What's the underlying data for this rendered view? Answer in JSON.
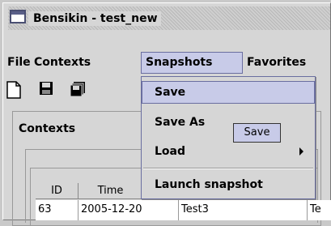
{
  "window": {
    "title": "Bensikin - test_new",
    "icon": "window-icon"
  },
  "menubar": {
    "items": [
      "File",
      "Contexts",
      "Snapshots",
      "Favorites"
    ],
    "active": "Snapshots"
  },
  "toolbar": {
    "icons": [
      "new-document-icon",
      "save-icon",
      "save-all-icon"
    ]
  },
  "dropdown": {
    "items": [
      {
        "label": "Save",
        "highlighted": true
      },
      {
        "label": "Save As"
      },
      {
        "label": "Load",
        "submenu": true
      },
      {
        "label": "Launch snapshot"
      }
    ]
  },
  "tooltip": {
    "text": "Save"
  },
  "contexts_panel": {
    "title": "Contexts",
    "columns": [
      "ID",
      "Time"
    ],
    "rows": [
      [
        "63",
        "2005-12-20",
        "Test3",
        "Te"
      ]
    ]
  },
  "colors": {
    "highlight": "#c8cbe8",
    "highlight_border": "#6a6ea0",
    "window_bg": "#d6d6d6"
  }
}
